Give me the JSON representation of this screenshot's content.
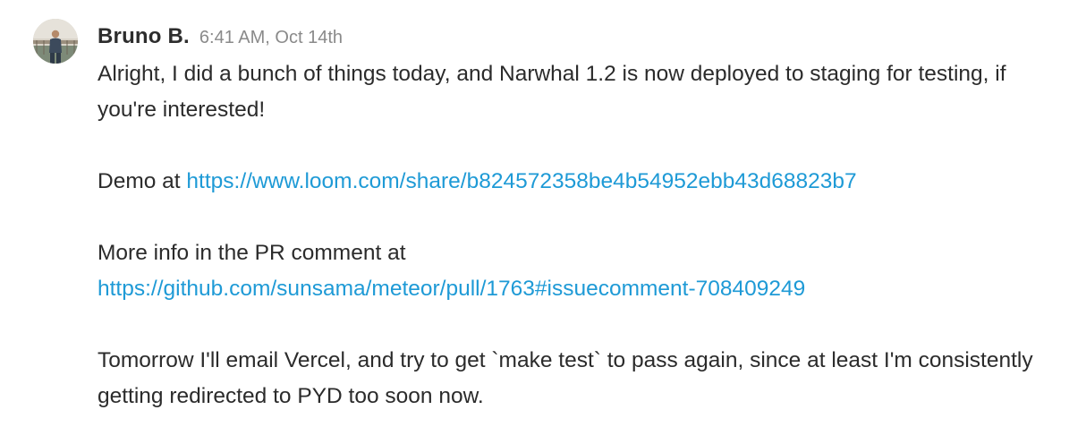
{
  "message": {
    "author": "Bruno B.",
    "timestamp": "6:41 AM, Oct 14th",
    "avatar_icon": "user-avatar-photo",
    "paragraphs": {
      "p1": "Alright, I did a bunch of things today, and Narwhal 1.2 is now deployed to staging for testing, if you're interested!",
      "p2_prefix": "Demo at ",
      "p2_link": "https://www.loom.com/share/b824572358be4b54952ebb43d68823b7",
      "p3_prefix": "More info in the PR comment at",
      "p3_link": "https://github.com/sunsama/meteor/pull/1763#issuecomment-708409249",
      "p4": "Tomorrow I'll email Vercel, and try to get `make test` to pass again, since at least I'm consistently getting redirected to PYD too soon now."
    }
  },
  "colors": {
    "link": "#1e9ad6",
    "text": "#2b2b2b",
    "timestamp": "#8a8a8a",
    "background": "#ffffff"
  }
}
